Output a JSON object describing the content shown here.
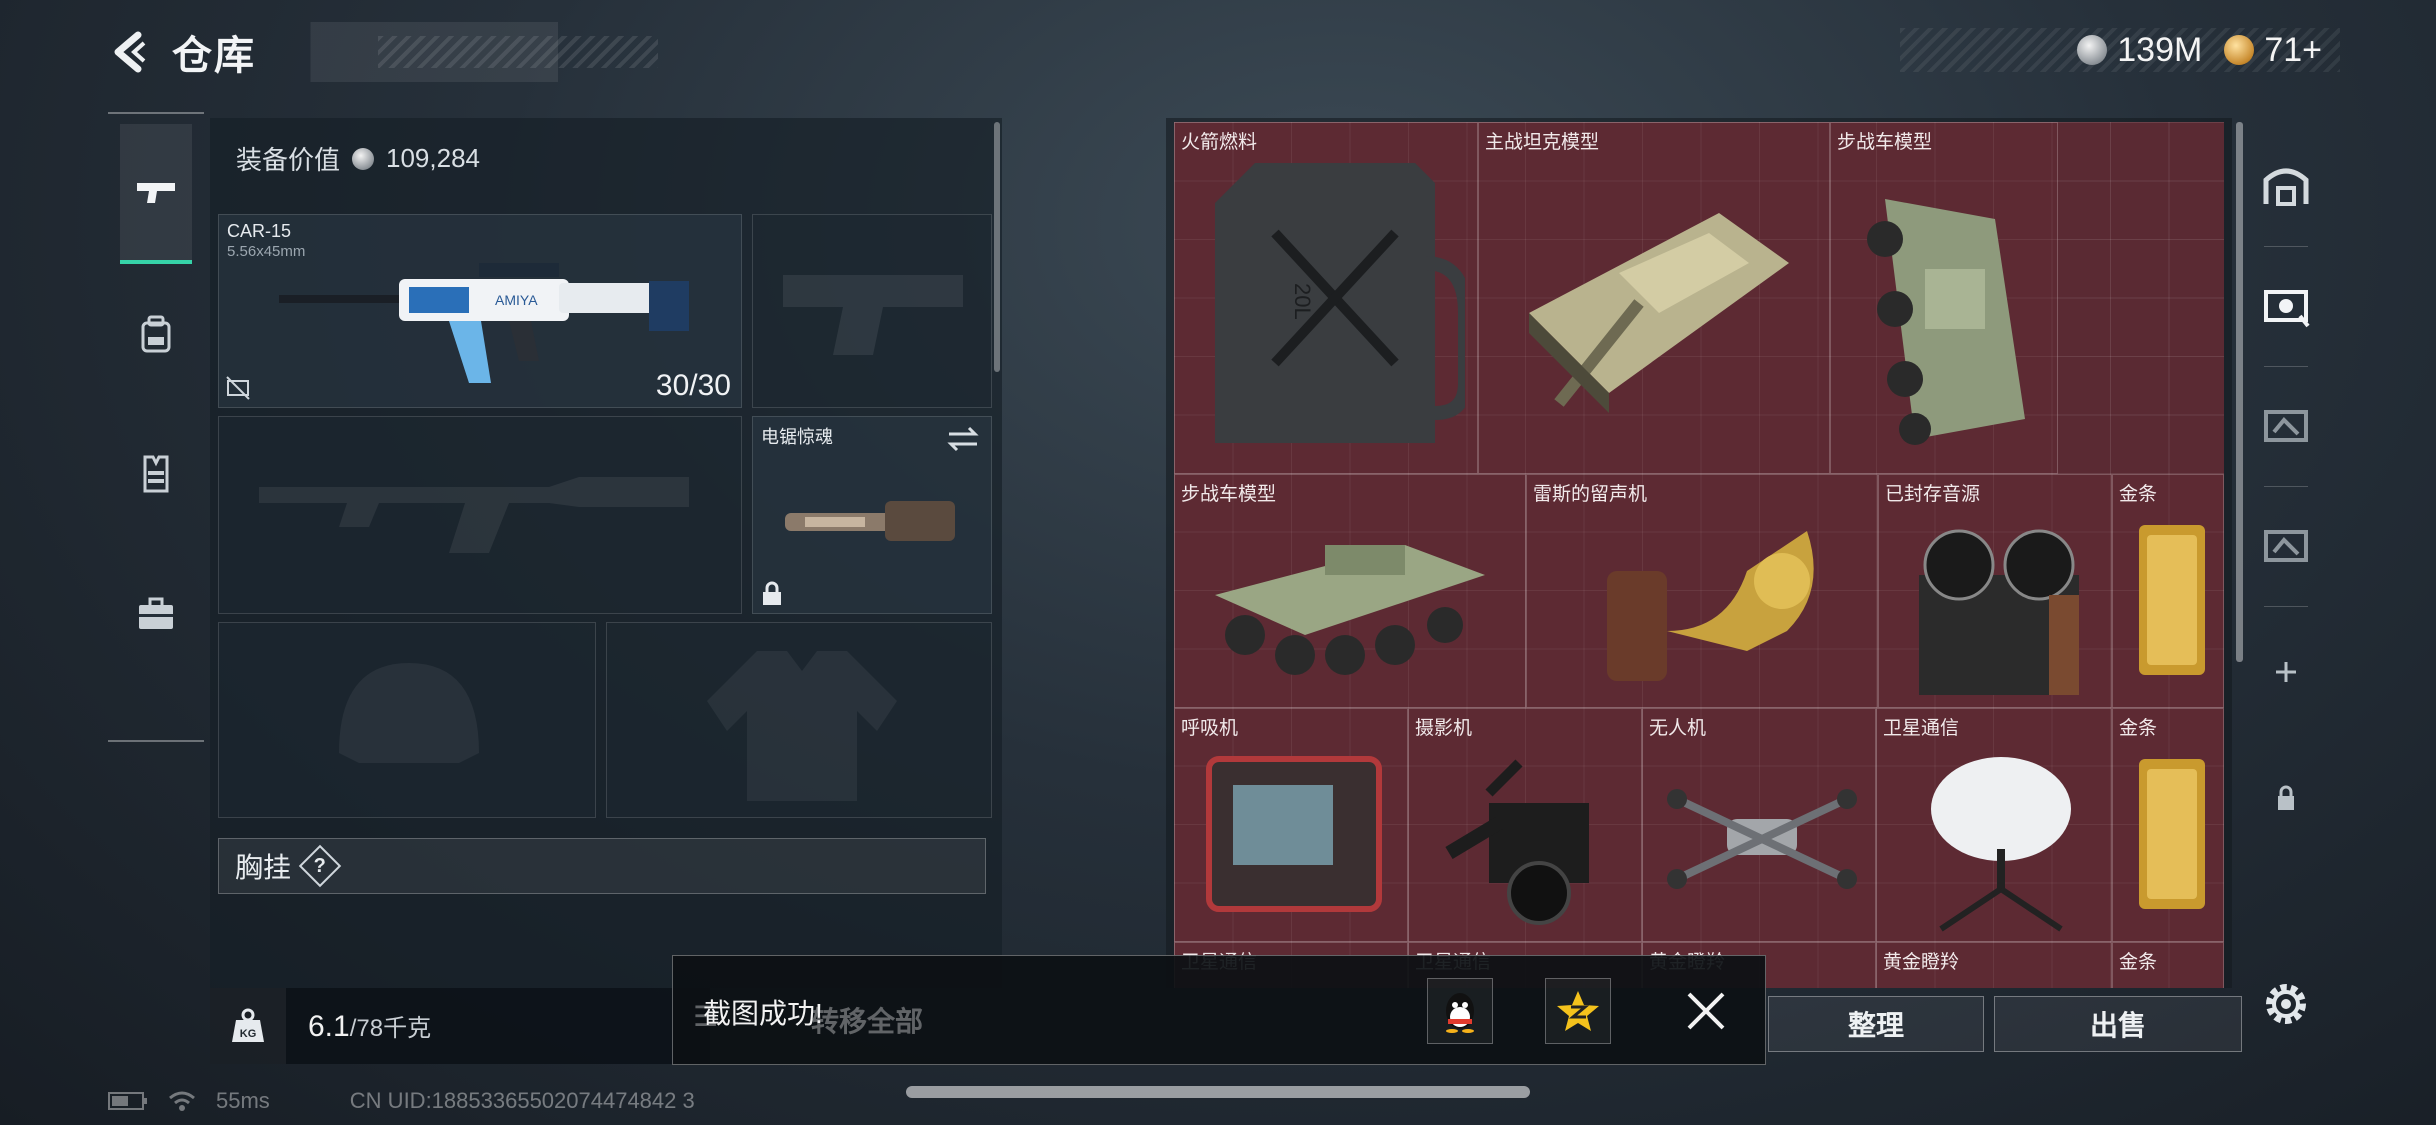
{
  "header": {
    "title": "仓库",
    "currencies": [
      {
        "name": "silver-coin",
        "value": "139M"
      },
      {
        "name": "gold-coin",
        "value": "71+"
      }
    ]
  },
  "left_nav": {
    "items": [
      {
        "icon": "pistol-icon",
        "active": true
      },
      {
        "icon": "backpack-icon",
        "active": false
      },
      {
        "icon": "vest-icon",
        "active": false
      },
      {
        "icon": "briefcase-icon",
        "active": false
      }
    ]
  },
  "equipment": {
    "value_label": "装备价值",
    "value": "109,284",
    "primary_weapon": {
      "name": "CAR-15",
      "caliber": "5.56x45mm",
      "ammo": "30/30"
    },
    "melee": {
      "name": "电锯惊魂"
    },
    "chest_rig_label": "胸挂",
    "chest_rig_help": "?"
  },
  "weight": {
    "current": "6.1",
    "max": "/78千克",
    "icon": "KG"
  },
  "storage": {
    "items": [
      {
        "label": "火箭燃料",
        "icon": "jerrycan-icon"
      },
      {
        "label": "主战坦克模型",
        "icon": "tank-icon"
      },
      {
        "label": "步战车模型",
        "icon": "ifv-icon"
      },
      {
        "label": "步战车模型",
        "icon": "ifv-icon"
      },
      {
        "label": "雷斯的留声机",
        "icon": "gramophone-icon"
      },
      {
        "label": "已封存音源",
        "icon": "tape-recorder-icon"
      },
      {
        "label": "金条",
        "icon": "gold-bar-icon"
      },
      {
        "label": "呼吸机",
        "icon": "ventilator-icon"
      },
      {
        "label": "摄影机",
        "icon": "camera-icon"
      },
      {
        "label": "无人机",
        "icon": "drone-icon"
      },
      {
        "label": "卫星通信",
        "icon": "satellite-dish-icon"
      },
      {
        "label": "金条",
        "icon": "gold-bar-icon"
      },
      {
        "label": "卫星通信",
        "icon": "satellite-dish-icon"
      },
      {
        "label": "卫星通信",
        "icon": "satellite-dish-icon"
      },
      {
        "label": "黄金瞪羚",
        "icon": "gazelle-icon"
      },
      {
        "label": "黄金瞪羚",
        "icon": "gazelle-icon"
      },
      {
        "label": "金条",
        "icon": "gold-bar-icon"
      }
    ]
  },
  "actions": {
    "transfer_all": "转移全部",
    "organize": "整理",
    "sell": "出售"
  },
  "toast": {
    "message": "截图成功!",
    "share_qq": "qq-icon",
    "share_qzone": "qzone-icon"
  },
  "status": {
    "ping": "55ms",
    "uid": "CN UID:18853365502074474842 3"
  },
  "colors": {
    "accent": "#36d3a8",
    "storage_bg": "#5a2a33",
    "panel_bg": "#1c2630"
  }
}
